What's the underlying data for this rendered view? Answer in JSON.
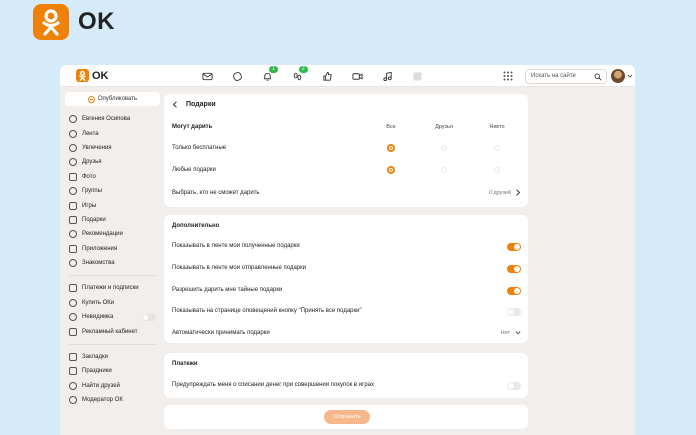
{
  "brand": {
    "name": "OK"
  },
  "topbar": {
    "logo_text": "OK",
    "badges": {
      "notifications": "1",
      "friends": "2"
    },
    "search_placeholder": "Искать на сайте"
  },
  "sidebar": {
    "publish_label": "Опубликовать",
    "group1": [
      {
        "label": "Евгения Осипова",
        "icon": "user-icon"
      },
      {
        "label": "Лента",
        "icon": "feed-icon"
      },
      {
        "label": "Увлечения",
        "icon": "hobby-icon"
      },
      {
        "label": "Друзья",
        "icon": "friends-icon"
      },
      {
        "label": "Фото",
        "icon": "photo-icon"
      },
      {
        "label": "Группы",
        "icon": "groups-icon"
      },
      {
        "label": "Игры",
        "icon": "games-icon"
      },
      {
        "label": "Подарки",
        "icon": "gift-icon"
      },
      {
        "label": "Рекомендации",
        "icon": "recommend-icon"
      },
      {
        "label": "Приложения",
        "icon": "apps-icon"
      },
      {
        "label": "Знакомства",
        "icon": "dating-icon"
      }
    ],
    "group2": [
      {
        "label": "Платежи и подписки",
        "icon": "payments-icon"
      },
      {
        "label": "Купить ОКи",
        "icon": "coin-icon"
      },
      {
        "label": "Невидимка",
        "icon": "invisible-icon"
      },
      {
        "label": "Рекламный кабинет",
        "icon": "ads-icon"
      }
    ],
    "group3": [
      {
        "label": "Закладки",
        "icon": "bookmark-icon"
      },
      {
        "label": "Праздники",
        "icon": "holiday-icon"
      },
      {
        "label": "Найти друзей",
        "icon": "find-friends-icon"
      },
      {
        "label": "Модератор ОК",
        "icon": "moderator-icon"
      }
    ]
  },
  "gifts": {
    "title": "Подарки",
    "who_can_give": "Могут дарить",
    "columns": [
      "Все",
      "Друзья",
      "Никто"
    ],
    "rows": [
      {
        "label": "Только бесплатные",
        "selected": 0
      },
      {
        "label": "Любые подарки",
        "selected": 0
      }
    ],
    "exclude_label": "Выбрать, кто не сможет дарить",
    "exclude_value": "0 друзей"
  },
  "additional": {
    "title": "Дополнительно",
    "items": [
      {
        "label": "Показывать в ленте мои полученные подарки",
        "on": true
      },
      {
        "label": "Показывать в ленте мои отправленные подарки",
        "on": true
      },
      {
        "label": "Разрешить дарить мне тайные подарки",
        "on": true
      },
      {
        "label": "Показывать на странице оповещений кнопку \"Принять все подарки\"",
        "on": false
      }
    ],
    "auto_accept_label": "Автоматически принимать подарки",
    "auto_accept_value": "Нет"
  },
  "payments": {
    "title": "Платежи",
    "warn_label": "Предупреждать меня о списании денег при совершении покупок в играх",
    "warn_on": false
  },
  "save_label": "Сохранить",
  "colors": {
    "accent": "#ee8208",
    "save_disabled": "#f6b78a",
    "badge": "#2fb84b"
  }
}
